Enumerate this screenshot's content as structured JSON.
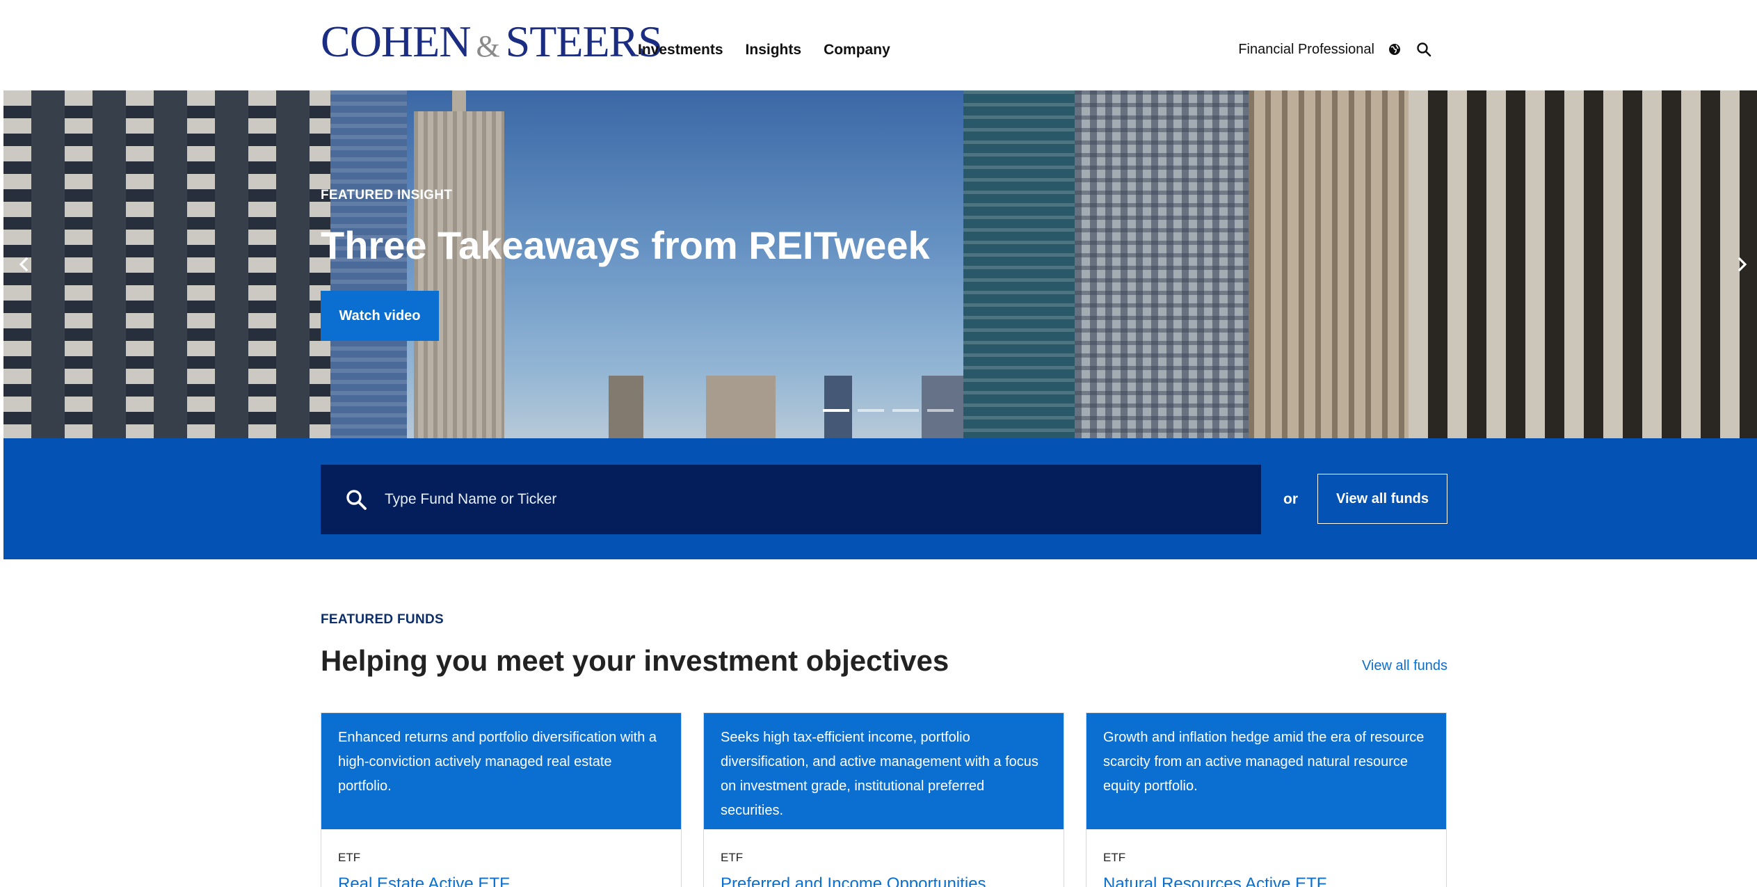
{
  "header": {
    "logo": {
      "part1": "COHEN",
      "amp": "&",
      "part2": "STEERS"
    },
    "nav": [
      "Investments",
      "Insights",
      "Company"
    ],
    "audience": "Financial Professional",
    "icons": {
      "globe": "globe-icon",
      "search": "search-icon"
    }
  },
  "hero": {
    "eyebrow": "FEATURED INSIGHT",
    "title": "Three Takeaways from REITweek",
    "button": "Watch video",
    "slides": 4,
    "active_slide": 1
  },
  "search": {
    "placeholder": "Type Fund Name or Ticker",
    "or": "or",
    "view_all": "View all funds"
  },
  "featured": {
    "eyebrow": "FEATURED FUNDS",
    "title": "Helping you meet your investment objectives",
    "link": "View all funds",
    "cards": [
      {
        "description": "Enhanced returns and portfolio diversification with a high-conviction actively managed real estate portfolio.",
        "type": "ETF",
        "name": "Real Estate Active ETF"
      },
      {
        "description": "Seeks high tax-efficient income, portfolio diversification, and active management with a focus on investment grade, institutional preferred securities.",
        "type": "ETF",
        "name": "Preferred and Income Opportunities"
      },
      {
        "description": "Growth and inflation hedge amid the era of resource scarcity from an active managed natural resource equity portfolio.",
        "type": "ETF",
        "name": "Natural Resources Active ETF"
      }
    ]
  },
  "colors": {
    "brand_blue": "#0552b5",
    "accent_blue": "#0a6fd0",
    "navy": "#031e5a",
    "logo_blue": "#1b2d83"
  }
}
